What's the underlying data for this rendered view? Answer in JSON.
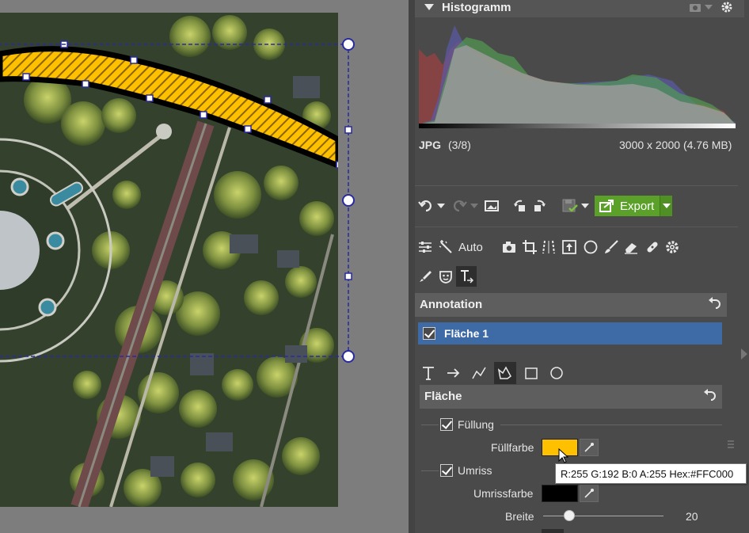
{
  "histogram": {
    "title": "Histogramm"
  },
  "image_info": {
    "format": "JPG",
    "index": "(3/8)",
    "dimensions": "3000 x 2000 (4.76 MB)"
  },
  "toolbar": {
    "export_label": "Export",
    "auto_label": "Auto"
  },
  "annotation": {
    "title": "Annotation",
    "layer_name": "Fläche 1",
    "layer_checked": true
  },
  "flaeche": {
    "title": "Fläche",
    "fill_label": "Füllung",
    "fill_color_label": "Füllfarbe",
    "fill_color": "#FFC000",
    "outline_label": "Umriss",
    "outline_color_label": "Umrissfarbe",
    "outline_color": "#000000",
    "width_label": "Breite",
    "width_value": "20"
  },
  "tooltip": {
    "text": "R:255 G:192 B:0 A:255 Hex:#FFC000"
  },
  "colors": {
    "accent_export": "#5aa029",
    "selection_blue": "#3e6aa6",
    "annotation_fill": "#FFC000"
  }
}
